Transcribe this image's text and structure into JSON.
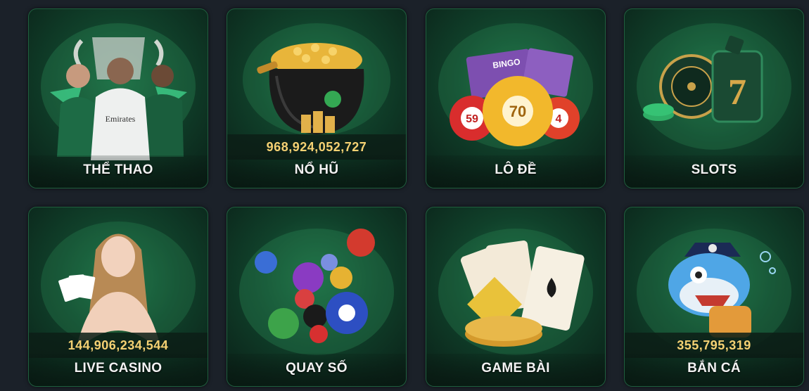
{
  "games": [
    {
      "label": "THỂ THAO",
      "jackpot": null
    },
    {
      "label": "NỔ HŨ",
      "jackpot": "968,924,052,727"
    },
    {
      "label": "LÔ ĐỀ",
      "jackpot": null
    },
    {
      "label": "SLOTS",
      "jackpot": null
    },
    {
      "label": "LIVE CASINO",
      "jackpot": "144,906,234,544"
    },
    {
      "label": "QUAY SỐ",
      "jackpot": null
    },
    {
      "label": "GAME BÀI",
      "jackpot": null
    },
    {
      "label": "BẮN CÁ",
      "jackpot": "355,795,319"
    }
  ],
  "art_text": {
    "bingo": "BINGO",
    "ball_59": "59",
    "ball_70": "70",
    "ball_4": "4",
    "jersey": "Emirates",
    "slot_seven": "7"
  },
  "colors": {
    "jackpot": "#f5d173",
    "card_glow": "#1c6a43",
    "background": "#1b2129"
  }
}
